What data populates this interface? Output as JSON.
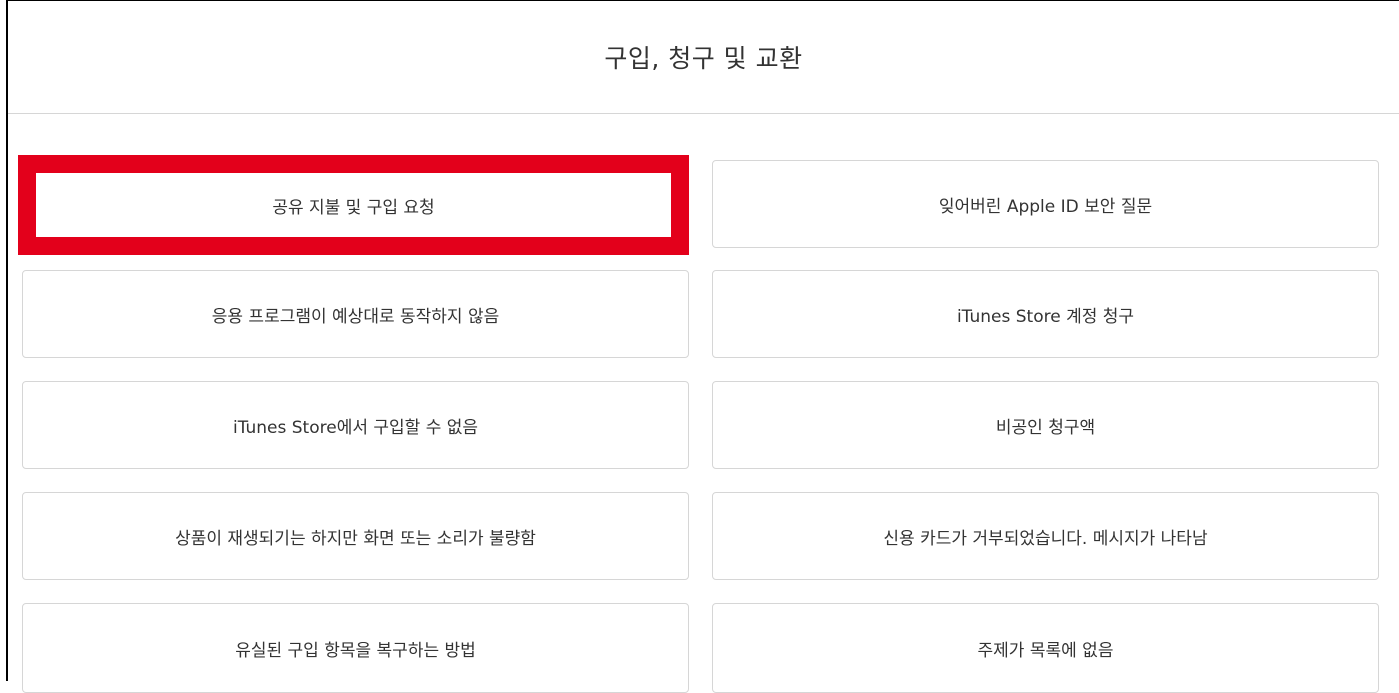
{
  "header": {
    "title": "구입, 청구 및 교환"
  },
  "options": {
    "left": [
      {
        "label": "공유 지불 및 구입 요청",
        "highlighted": true
      },
      {
        "label": "응용 프로그램이 예상대로 동작하지 않음"
      },
      {
        "label": "iTunes Store에서 구입할 수 없음"
      },
      {
        "label": "상품이 재생되기는 하지만 화면 또는 소리가 불량함"
      },
      {
        "label": "유실된 구입 항목을 복구하는 방법"
      }
    ],
    "right": [
      {
        "label": "잊어버린 Apple ID 보안 질문"
      },
      {
        "label": "iTunes Store 계정 청구"
      },
      {
        "label": "비공인 청구액"
      },
      {
        "label": "신용 카드가 거부되었습니다. 메시지가 나타남"
      },
      {
        "label": "주제가 목록에 없음"
      }
    ]
  },
  "colors": {
    "highlight": "#e3001b",
    "border": "#d6d6d6",
    "text": "#333333"
  }
}
